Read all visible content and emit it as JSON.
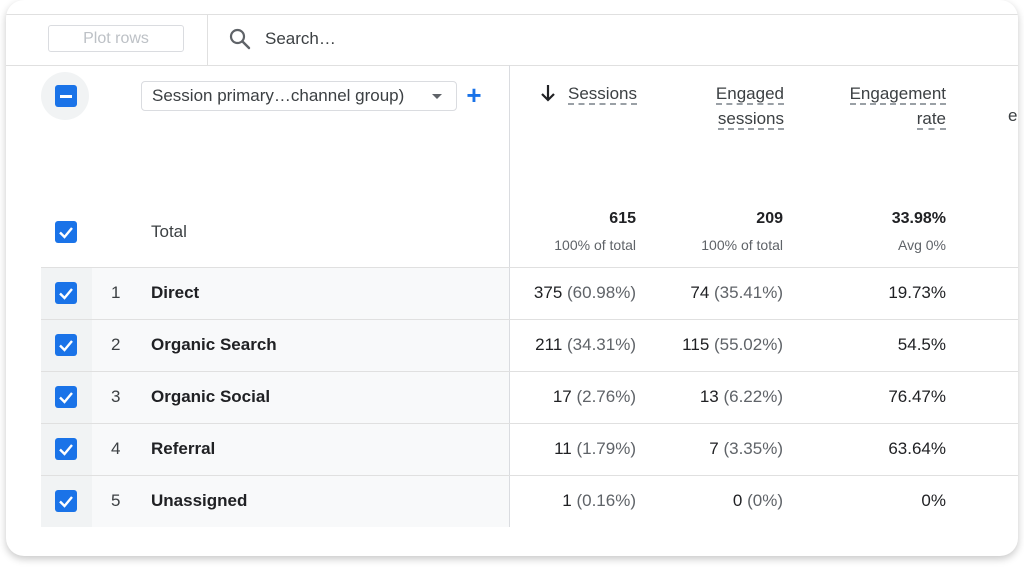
{
  "toolbar": {
    "plot_rows_label": "Plot rows",
    "search_placeholder": "Search…"
  },
  "header": {
    "dimension_select_value": "Session primary…channel group)",
    "add_dimension_label": "+",
    "columns": [
      {
        "line1": "Sessions",
        "line2": "",
        "sorted": "descending"
      },
      {
        "line1": "Engaged",
        "line2": "sessions"
      },
      {
        "line1": "Engagement",
        "line2": "rate"
      }
    ]
  },
  "totals": {
    "label": "Total",
    "values": [
      {
        "value": "615",
        "sub": "100% of total"
      },
      {
        "value": "209",
        "sub": "100% of total"
      },
      {
        "value": "33.98%",
        "sub": "Avg 0%"
      }
    ]
  },
  "rows": [
    {
      "index": "1",
      "name": "Direct",
      "sessions": "375",
      "sessions_pct": "(60.98%)",
      "engaged": "74",
      "engaged_pct": "(35.41%)",
      "rate": "19.73%"
    },
    {
      "index": "2",
      "name": "Organic Search",
      "sessions": "211",
      "sessions_pct": "(34.31%)",
      "engaged": "115",
      "engaged_pct": "(55.02%)",
      "rate": "54.5%"
    },
    {
      "index": "3",
      "name": "Organic Social",
      "sessions": "17",
      "sessions_pct": "(2.76%)",
      "engaged": "13",
      "engaged_pct": "(6.22%)",
      "rate": "76.47%"
    },
    {
      "index": "4",
      "name": "Referral",
      "sessions": "11",
      "sessions_pct": "(1.79%)",
      "engaged": "7",
      "engaged_pct": "(3.35%)",
      "rate": "63.64%"
    },
    {
      "index": "5",
      "name": "Unassigned",
      "sessions": "1",
      "sessions_pct": "(0.16%)",
      "engaged": "0",
      "engaged_pct": "(0%)",
      "rate": "0%"
    }
  ],
  "colors": {
    "accent": "#1a73e8",
    "row_left_bg": "#f8f9fa",
    "divider": "#e0e0e0"
  },
  "icons": {
    "search": "search-icon",
    "sort": "arrow-down-icon",
    "checkbox": "checkbox-checked-icon",
    "select_all": "checkbox-indeterminate-icon"
  }
}
